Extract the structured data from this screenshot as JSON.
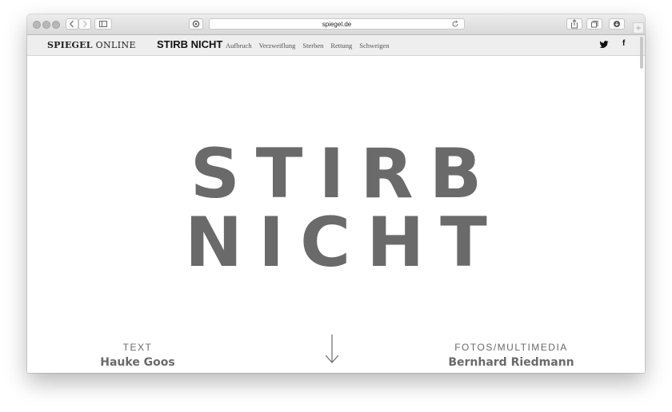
{
  "browser": {
    "url": "spiegel.de"
  },
  "site": {
    "logo_bold": "SPIEGEL",
    "logo_light": " ONLINE",
    "brand": "STIRB NICHT",
    "nav": [
      "Aufbruch",
      "Verzweiflung",
      "Sterben",
      "Rettung",
      "Schweigen"
    ],
    "social": {
      "facebook": "f"
    }
  },
  "hero": {
    "headline": "STIRB NICHT",
    "text_role": "TEXT",
    "text_name": "Hauke Goos",
    "media_role": "FOTOS/MULTIMEDIA",
    "media_name": "Bernhard Riedmann"
  },
  "colors": {
    "headline": "#6a6a6a",
    "navbar_bg": "#eeeeee"
  }
}
